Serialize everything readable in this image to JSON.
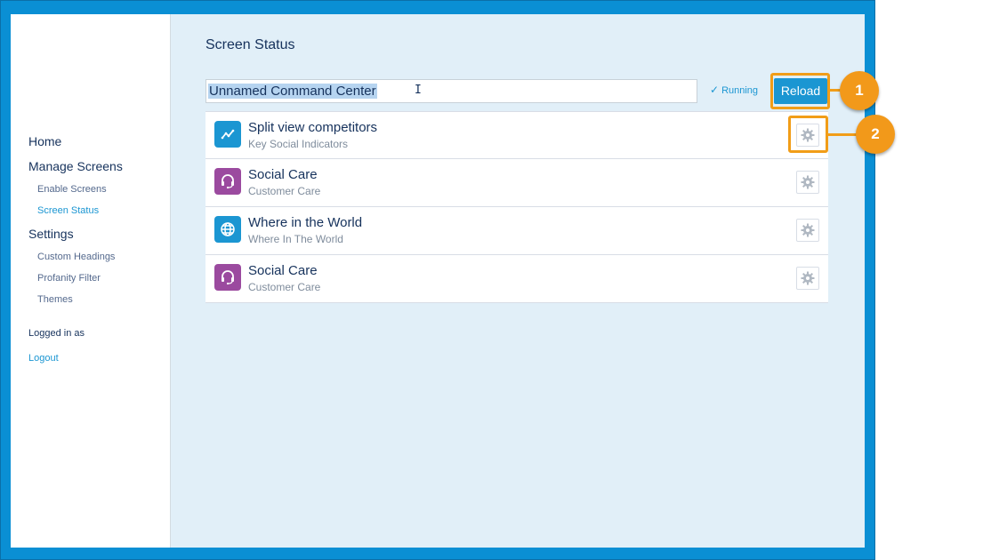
{
  "sidebar": {
    "items": [
      {
        "label": "Home",
        "level": "top",
        "active": false
      },
      {
        "label": "Manage Screens",
        "level": "top",
        "active": false
      },
      {
        "label": "Enable Screens",
        "level": "sub",
        "active": false
      },
      {
        "label": "Screen Status",
        "level": "sub",
        "active": true
      },
      {
        "label": "Settings",
        "level": "top",
        "active": false
      },
      {
        "label": "Custom Headings",
        "level": "sub",
        "active": false
      },
      {
        "label": "Profanity Filter",
        "level": "sub",
        "active": false
      },
      {
        "label": "Themes",
        "level": "sub",
        "active": false
      }
    ],
    "logged_in_label": "Logged in as",
    "logout_label": "Logout"
  },
  "main": {
    "title": "Screen Status",
    "name_input_value": "Unnamed Command Center",
    "status_label": "Running",
    "reload_label": "Reload",
    "screens": [
      {
        "title": "Split view competitors",
        "subtitle": "Key Social Indicators",
        "icon": "line-chart-icon",
        "icon_color": "#1b96d2"
      },
      {
        "title": "Social Care",
        "subtitle": "Customer Care",
        "icon": "headset-icon",
        "icon_color": "#9b4a9f"
      },
      {
        "title": "Where in the World",
        "subtitle": "Where In The World",
        "icon": "globe-icon",
        "icon_color": "#1b96d2"
      },
      {
        "title": "Social Care",
        "subtitle": "Customer Care",
        "icon": "headset-icon",
        "icon_color": "#9b4a9f"
      }
    ]
  },
  "callouts": [
    "1",
    "2"
  ],
  "colors": {
    "accent": "#1b96d2",
    "callout": "#f2991a",
    "background": "#e1eff8",
    "frame": "#0a8fd4"
  }
}
